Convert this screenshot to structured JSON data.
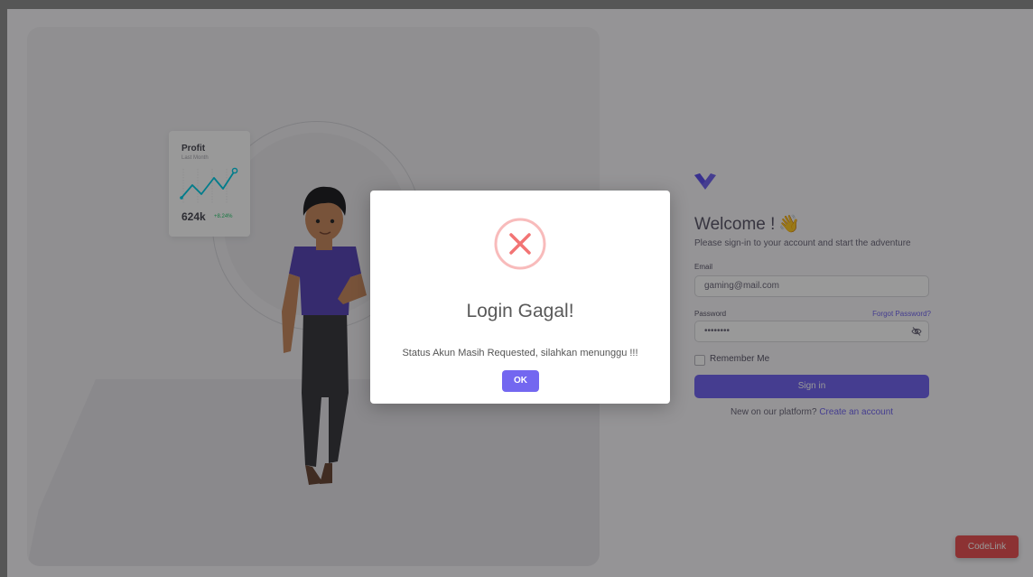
{
  "illustration": {
    "profit_card": {
      "title": "Profit",
      "subtitle": "Last Month",
      "value": "624k",
      "change": "+8.24%"
    }
  },
  "login": {
    "welcome_title": "Welcome !",
    "welcome_emoji": "👋",
    "subtitle": "Please sign-in to your account and start the adventure",
    "email_label": "Email",
    "email_value": "gaming@mail.com",
    "password_label": "Password",
    "forgot_password": "Forgot Password?",
    "password_value": "••••••••",
    "remember_me": "Remember Me",
    "sign_in": "Sign in",
    "new_on_platform": "New on our platform?",
    "create_account": "Create an account"
  },
  "modal": {
    "title": "Login Gagal!",
    "message": "Status Akun Masih Requested, silahkan menunggu !!!",
    "ok_label": "OK"
  },
  "badge": {
    "label": "CodeLink"
  },
  "colors": {
    "primary": "#7367f0",
    "error": "#f27474",
    "success": "#28c76f",
    "badge": "#ea5455"
  }
}
